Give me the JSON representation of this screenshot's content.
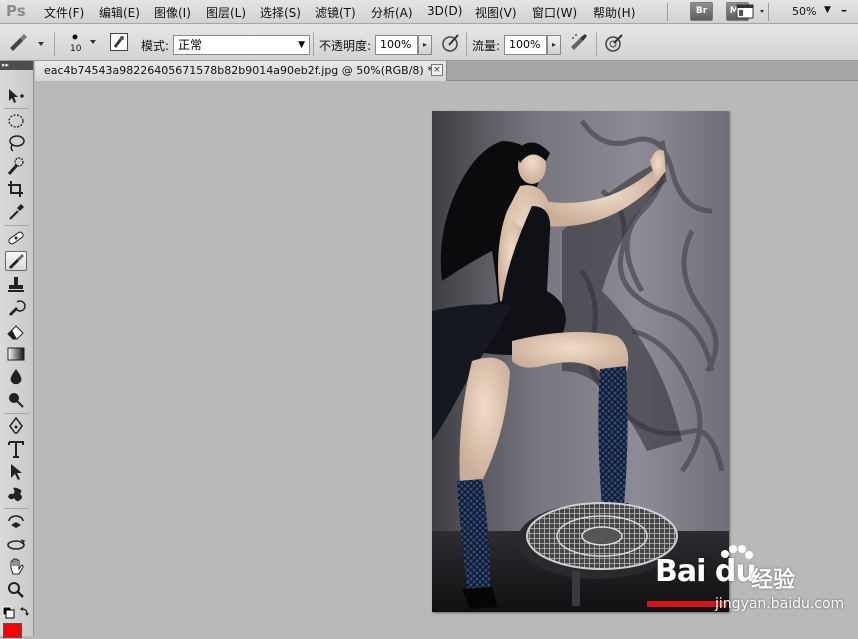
{
  "app": {
    "logo": "Ps"
  },
  "menubar": {
    "items": [
      "文件(F)",
      "编辑(E)",
      "图像(I)",
      "图层(L)",
      "选择(S)",
      "滤镜(T)",
      "分析(A)",
      "3D(D)",
      "视图(V)",
      "窗口(W)",
      "帮助(H)"
    ],
    "bridge_label": "Br",
    "minibridge_label": "Mb",
    "zoom": "50%"
  },
  "options": {
    "brush_size": "10",
    "mode_label": "模式:",
    "mode_value": "正常",
    "opacity_label": "不透明度:",
    "opacity_value": "100%",
    "flow_label": "流量:",
    "flow_value": "100%"
  },
  "document": {
    "tab_title": "eac4b74543a98226405671578b82b9014a90eb2f.jpg @ 50%(RGB/8) *",
    "close_glyph": "×"
  },
  "tools": [
    "move-tool",
    "marquee-tool",
    "lasso-tool",
    "quick-selection-tool",
    "crop-tool",
    "eyedropper-tool",
    "spot-healing-tool",
    "brush-tool",
    "clone-stamp-tool",
    "history-brush-tool",
    "eraser-tool",
    "gradient-tool",
    "blur-tool",
    "dodge-tool",
    "pen-tool",
    "type-tool",
    "path-selection-tool",
    "shape-tool",
    "3d-rotate-tool",
    "3d-orbit-tool",
    "hand-tool",
    "zoom-tool"
  ],
  "colors": {
    "foreground": "#000000",
    "background": "#ff0000"
  },
  "watermark": {
    "logo": "Bai du",
    "brand": "经验",
    "url": "jingyan.baidu.com"
  }
}
